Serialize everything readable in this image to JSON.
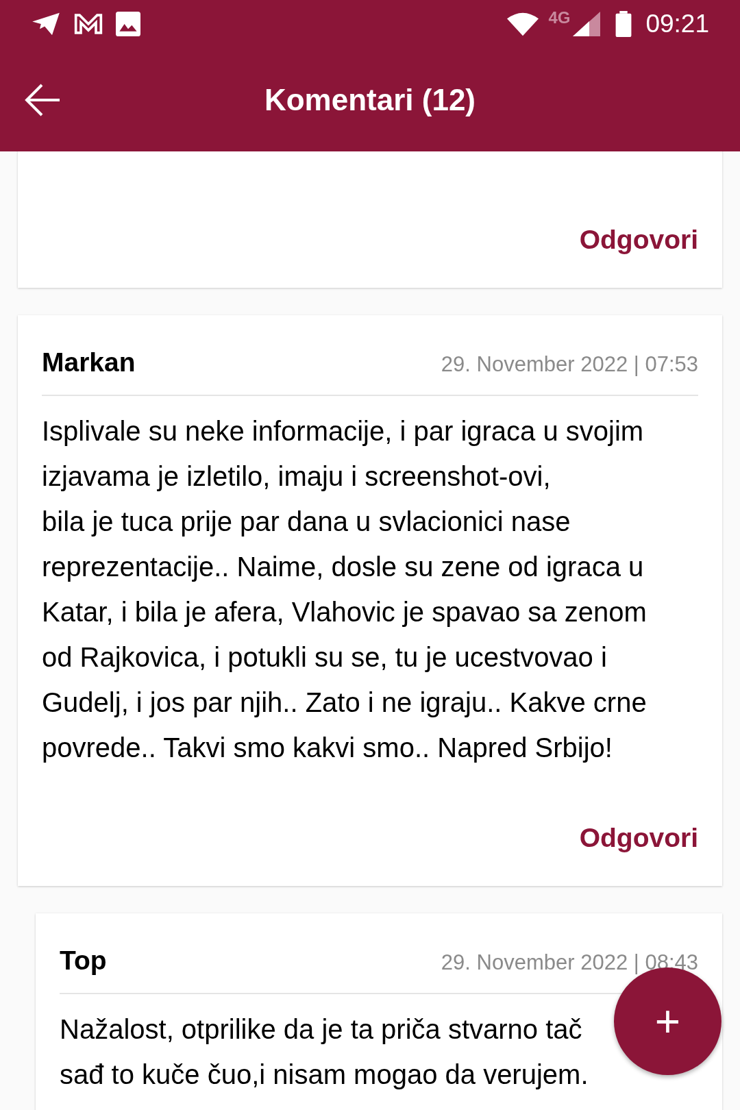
{
  "status_bar": {
    "network": "4G",
    "time": "09:21"
  },
  "app_bar": {
    "title": "Komentari (12)"
  },
  "comments": [
    {
      "reply": "Odgovori",
      "nested": false
    },
    {
      "author": "Markan",
      "date": "29. November 2022 | 07:53",
      "lines": [
        "Isplivale su neke informacije, i par igraca u svojim",
        "izjavama je izletilo, imaju i screenshot-ovi,",
        "bila je tuca prije par dana u svlacionici nase",
        "reprezentacije.. Naime, dosle su zene od igraca u",
        "Katar, i bila je afera, Vlahovic je spavao sa zenom",
        "od Rajkovica, i potukli su se, tu je ucestvovao i",
        "Gudelj, i jos par njih.. Zato i ne igraju.. Kakve crne",
        "povrede.. Takvi smo kakvi smo.. Napred Srbijo!"
      ],
      "reply": "Odgovori",
      "nested": false
    },
    {
      "author": "Top",
      "date": "29. November 2022 | 08:43",
      "lines": [
        "Nažalost, otprilike da je ta priča stvarno tač",
        "sađ to kuče čuo,i nisam mogao da verujem."
      ],
      "nested": true
    }
  ],
  "fab": {
    "label": "+"
  }
}
